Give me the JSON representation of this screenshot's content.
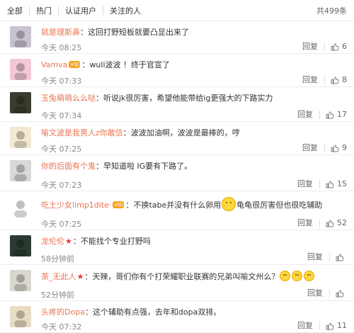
{
  "filter_tabs": [
    "全部",
    "热门",
    "认证用户",
    "关注的人"
  ],
  "total_count": "共499条",
  "reply_label": "回复",
  "colors": {
    "username": "#eb7350",
    "star": "#e8352a",
    "badge": "#f7a21d"
  },
  "comments": [
    {
      "username": "就是理斯鼻",
      "badge": "",
      "star": false,
      "text": "这回打野短板就要凸显出来了",
      "time": "今天 08:25",
      "likes": "6",
      "emoji": ""
    },
    {
      "username": "Vamva",
      "badge": "vip",
      "star": false,
      "text": "wuli波波 ！终于官宣了",
      "time": "今天 07:33",
      "likes": "8",
      "emoji": ""
    },
    {
      "username": "玉兔萌萌么么哒",
      "badge": "",
      "star": false,
      "text": "听说jk很厉害，希望他能带给ig更强大的下路实力",
      "time": "今天 07:34",
      "likes": "17",
      "emoji": ""
    },
    {
      "username": "喻文波是我男人z你敢信",
      "badge": "",
      "star": false,
      "text": "波波加油啊，波波是最棒的，哼",
      "time": "今天 07:25",
      "likes": "9",
      "emoji": ""
    },
    {
      "username": "你的后面有个鬼",
      "badge": "",
      "star": false,
      "text": "早知道啦 IG要有下路了。",
      "time": "今天 07:23",
      "likes": "15",
      "emoji": ""
    },
    {
      "username": "吃土少女limp1dite·",
      "badge": "vip",
      "star": false,
      "text": "不换tabe并没有什么卵用",
      "text_after": "龟龟很厉害但也很吃辅助",
      "time": "今天 07:25",
      "likes": "52",
      "emoji": "big"
    },
    {
      "username": "龙伦伦",
      "badge": "",
      "star": true,
      "text": "不能找个专业打野吗",
      "time": "58分钟前",
      "likes": "",
      "emoji": ""
    },
    {
      "username": "茶_无此人",
      "badge": "",
      "star": true,
      "text": "天辣，哥们你有个打荣耀职业联赛的兄弟叫喻文州么？",
      "time": "52分钟前",
      "likes": "",
      "emoji": "triple"
    },
    {
      "username": "头疼的Dopa",
      "badge": "",
      "star": false,
      "text": "这个辅助有点强，去年和dopa双排。",
      "time": "今天 07:32",
      "likes": "11",
      "emoji": ""
    }
  ]
}
